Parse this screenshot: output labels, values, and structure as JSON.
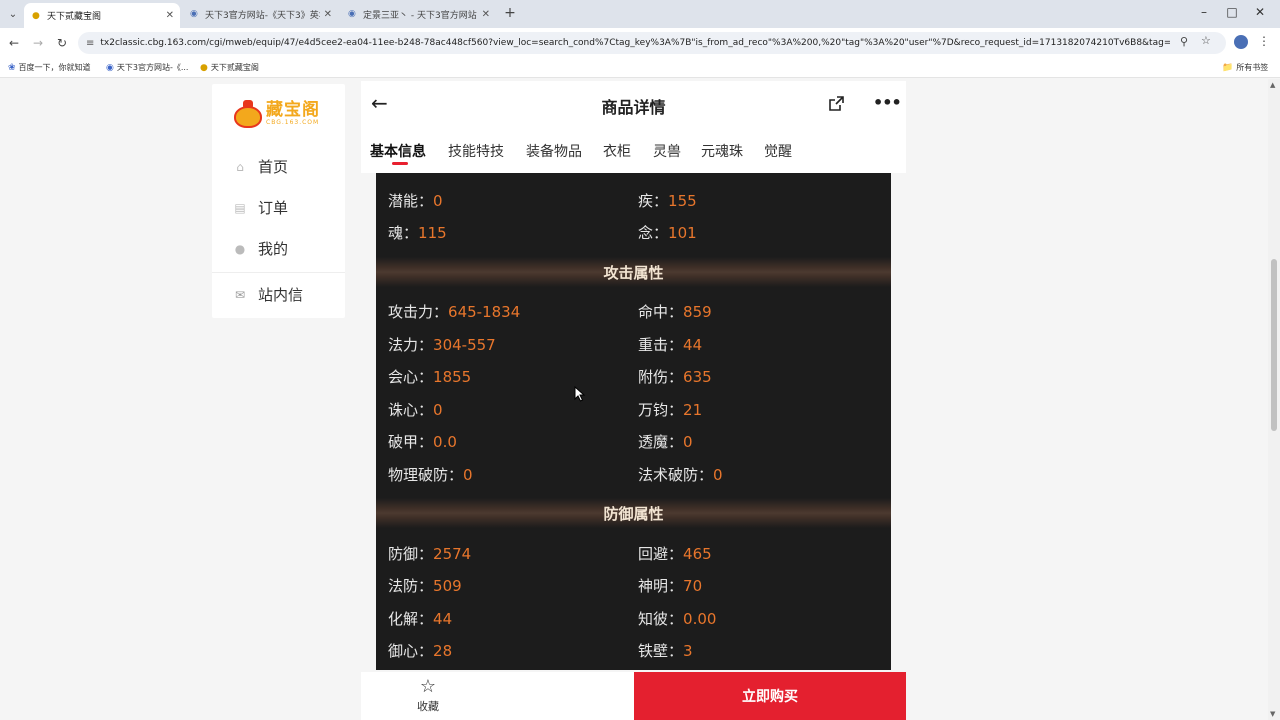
{
  "browser": {
    "tabs": [
      {
        "title": "天下贰藏宝阁",
        "active": true
      },
      {
        "title": "天下3官方网站-《天下3》英华",
        "active": false
      },
      {
        "title": "定景三亚丶 - 天下3官方网站",
        "active": false
      }
    ],
    "url": "tx2classic.cbg.163.com/cgi/mweb/equip/47/e4d5cee2-ea04-11ee-b248-78ac448cf560?view_loc=search_cond%7Ctag_key%3A%7B\"is_from_ad_reco\"%3A%200,%20\"tag\"%3A%20\"user\"%7D&reco_request_id=1713182074210Tv6B8&tag=user",
    "bookmarks": [
      "百度一下，你就知道",
      "天下3官方网站-《...",
      "天下贰藏宝阁"
    ],
    "all_bookmarks": "所有书签"
  },
  "sidebar": {
    "logo_cn": "藏宝阁",
    "logo_en": "CBG.163.COM",
    "items": [
      {
        "label": "首页",
        "icon": "home-icon"
      },
      {
        "label": "订单",
        "icon": "order-icon"
      },
      {
        "label": "我的",
        "icon": "user-icon"
      },
      {
        "label": "站内信",
        "icon": "mail-icon"
      }
    ]
  },
  "header": {
    "title": "商品详情"
  },
  "tabs": [
    "基本信息",
    "技能特技",
    "装备物品",
    "衣柜",
    "灵兽",
    "元魂珠",
    "觉醒"
  ],
  "attributes": {
    "basic": [
      {
        "label": "潜能",
        "value": "0"
      },
      {
        "label": "疾",
        "value": "155"
      },
      {
        "label": "魂",
        "value": "115"
      },
      {
        "label": "念",
        "value": "101"
      }
    ],
    "attack_title": "攻击属性",
    "attack": [
      {
        "label": "攻击力",
        "value": "645-1834"
      },
      {
        "label": "命中",
        "value": "859"
      },
      {
        "label": "法力",
        "value": "304-557"
      },
      {
        "label": "重击",
        "value": "44"
      },
      {
        "label": "会心",
        "value": "1855"
      },
      {
        "label": "附伤",
        "value": "635"
      },
      {
        "label": "诛心",
        "value": "0"
      },
      {
        "label": "万钧",
        "value": "21"
      },
      {
        "label": "破甲",
        "value": "0.0"
      },
      {
        "label": "透魔",
        "value": "0"
      },
      {
        "label": "物理破防",
        "value": "0"
      },
      {
        "label": "法术破防",
        "value": "0"
      }
    ],
    "defense_title": "防御属性",
    "defense": [
      {
        "label": "防御",
        "value": "2574"
      },
      {
        "label": "回避",
        "value": "465"
      },
      {
        "label": "法防",
        "value": "509"
      },
      {
        "label": "神明",
        "value": "70"
      },
      {
        "label": "化解",
        "value": "44"
      },
      {
        "label": "知彼",
        "value": "0.00"
      },
      {
        "label": "御心",
        "value": "28"
      },
      {
        "label": "铁壁",
        "value": "3"
      }
    ]
  },
  "bottom": {
    "favorite_label": "收藏",
    "buy_label": "立即购买"
  }
}
